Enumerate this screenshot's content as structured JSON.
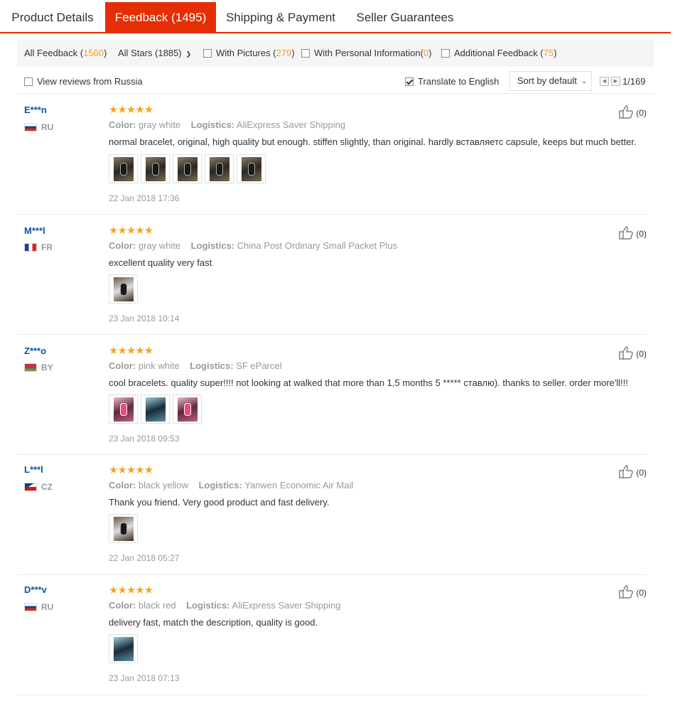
{
  "tabs": [
    {
      "label": "Product Details"
    },
    {
      "label": "Feedback (1495)"
    },
    {
      "label": "Shipping & Payment"
    },
    {
      "label": "Seller Guarantees"
    }
  ],
  "filters": {
    "all_feedback": {
      "label": "All Feedback (",
      "count": "1560",
      "close": ")"
    },
    "all_stars": {
      "label": "All Stars (1885)"
    },
    "with_pictures": {
      "label": "With Pictures (",
      "count": "279",
      "close": ")"
    },
    "with_personal": {
      "label": "With Personal Information(",
      "count": "0",
      "close": ")"
    },
    "additional": {
      "label": "Additional Feedback (",
      "count": "75",
      "close": ")"
    }
  },
  "toolbar": {
    "view_russia": "View reviews from Russia",
    "translate": "Translate to English",
    "sort": "Sort by default",
    "page": "1/169"
  },
  "colors": {
    "accent": "#e62e04",
    "star": "#f5a623",
    "count": "#f29d2b",
    "user": "#0a56a8"
  },
  "reviews": [
    {
      "user": "E***n",
      "country": "RU",
      "stars": "★★★★★",
      "color_label": "Color:",
      "color": "gray white",
      "logistics_label": "Logistics:",
      "logistics": "AliExpress Saver Shipping",
      "text": "normal bracelet, original, high quality but enough. stiffen slightly, than original. hardly вставляетс capsule, keeps but much better.",
      "date": "22 Jan 2018 17:36",
      "likes": "(0)"
    },
    {
      "user": "M***l",
      "country": "FR",
      "stars": "★★★★★",
      "color_label": "Color:",
      "color": "gray white",
      "logistics_label": "Logistics:",
      "logistics": "China Post Ordinary Small Packet Plus",
      "text": "excellent quality very fast",
      "date": "23 Jan 2018 10:14",
      "likes": "(0)"
    },
    {
      "user": "Z***o",
      "country": "BY",
      "stars": "★★★★★",
      "color_label": "Color:",
      "color": "pink white",
      "logistics_label": "Logistics:",
      "logistics": "SF eParcel",
      "text": "cool bracelets. quality super!!!! not looking at walked that more than 1,5 months 5 ***** ставлю). thanks to seller. order more'll!!!",
      "date": "23 Jan 2018 09:53",
      "likes": "(0)"
    },
    {
      "user": "L***l",
      "country": "CZ",
      "stars": "★★★★★",
      "color_label": "Color:",
      "color": "black yellow",
      "logistics_label": "Logistics:",
      "logistics": "Yanwen Economic Air Mail",
      "text": "Thank you friend. Very good product and fast delivery.",
      "date": "22 Jan 2018 05:27",
      "likes": "(0)"
    },
    {
      "user": "D***v",
      "country": "RU",
      "stars": "★★★★★",
      "color_label": "Color:",
      "color": "black red",
      "logistics_label": "Logistics:",
      "logistics": "AliExpress Saver Shipping",
      "text": "delivery fast, match the description, quality is good.",
      "date": "23 Jan 2018 07:13",
      "likes": "(0)"
    }
  ]
}
